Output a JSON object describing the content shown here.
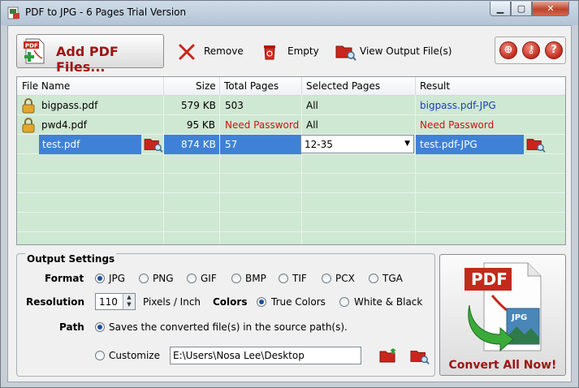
{
  "window": {
    "title": "PDF to JPG - 6 Pages Trial Version",
    "min": "▁",
    "max": "▢",
    "close": "✕"
  },
  "toolbar": {
    "add_label": "Add PDF Files...",
    "remove_label": "Remove",
    "empty_label": "Empty",
    "view_label": "View Output File(s)"
  },
  "table": {
    "columns": [
      "File Name",
      "Size",
      "Total Pages",
      "Selected Pages",
      "Result"
    ],
    "rows": [
      {
        "name": "bigpass.pdf",
        "size": "579 KB",
        "pages": "503",
        "selected": "All",
        "result": "bigpass.pdf-JPG"
      },
      {
        "name": "pwd4.pdf",
        "size": "95 KB",
        "pages": "Need Password",
        "selected": "All",
        "result": "Need Password"
      },
      {
        "name": "test.pdf",
        "size": "874 KB",
        "pages": "57",
        "selected": "12-35",
        "result": "test.pdf-JPG"
      }
    ]
  },
  "settings": {
    "legend": "Output Settings",
    "format_label": "Format",
    "formats": [
      "JPG",
      "PNG",
      "GIF",
      "BMP",
      "TIF",
      "PCX",
      "TGA"
    ],
    "format_selected": "JPG",
    "resolution_label": "Resolution",
    "resolution_value": "110",
    "resolution_unit": "Pixels / Inch",
    "colors_label": "Colors",
    "color_true": "True Colors",
    "color_bw": "White & Black",
    "color_selected": "True Colors",
    "path_label": "Path",
    "path_source": "Saves the converted file(s) in the source path(s).",
    "path_custom_label": "Customize",
    "path_custom_value": "E:\\Users\\Nosa Lee\\Desktop"
  },
  "convert": {
    "label": "Convert All Now!",
    "badge_pdf": "PDF",
    "badge_jpg": "JPG"
  },
  "colors": {
    "accent_red": "#a01313",
    "link_blue": "#1a3fc0",
    "error_red": "#d01010",
    "selection": "#3f81d6",
    "row_bg": "#cfe8d3"
  }
}
